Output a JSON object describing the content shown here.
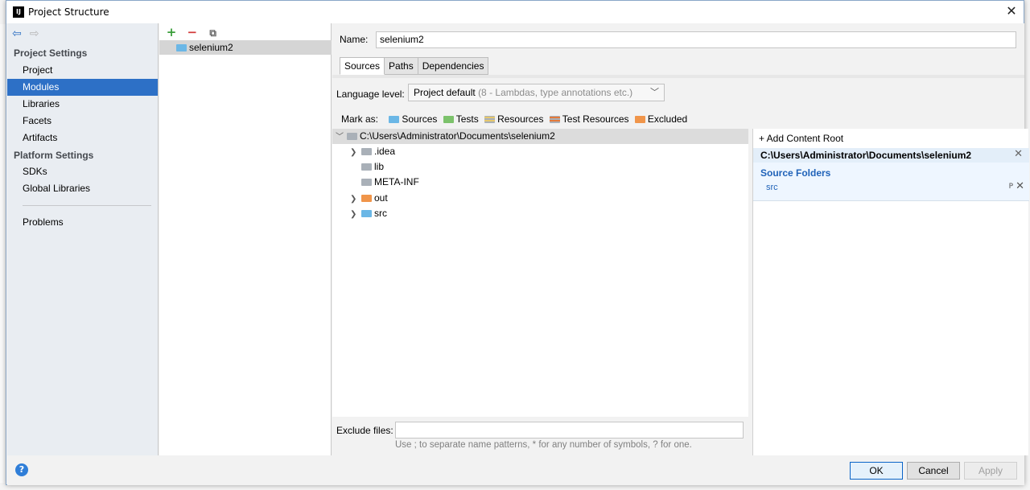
{
  "window": {
    "title": "Project Structure",
    "icon_text": "IJ"
  },
  "nav": {
    "back_icon": "⇦",
    "forward_icon": "⇨",
    "sections": [
      {
        "label": "Project Settings"
      },
      {
        "label": "Platform Settings"
      }
    ],
    "items": [
      {
        "label": "Project"
      },
      {
        "label": "Modules"
      },
      {
        "label": "Libraries"
      },
      {
        "label": "Facets"
      },
      {
        "label": "Artifacts"
      },
      {
        "label": "SDKs"
      },
      {
        "label": "Global Libraries"
      },
      {
        "label": "Problems"
      }
    ],
    "selected": "Modules"
  },
  "modules": {
    "toolbar": {
      "add": "+",
      "remove": "−",
      "copy": "⧉"
    },
    "items": [
      {
        "label": "selenium2"
      }
    ]
  },
  "main": {
    "name_label": "Name:",
    "name_value": "selenium2",
    "tabs": [
      {
        "label": "Sources"
      },
      {
        "label": "Paths"
      },
      {
        "label": "Dependencies"
      }
    ],
    "active_tab": "Sources",
    "language_level_label": "Language level:",
    "language_level_value": "Project default",
    "language_level_hint": "(8 - Lambdas, type annotations etc.)",
    "mark_as_label": "Mark as:",
    "mark_as_options": [
      {
        "label": "Sources",
        "color": "#6bb7e6"
      },
      {
        "label": "Tests",
        "color": "#7cc26b"
      },
      {
        "label": "Resources",
        "color": "#a9b0b8"
      },
      {
        "label": "Test Resources",
        "color": "#e47a3a"
      },
      {
        "label": "Excluded",
        "color": "#f0954a"
      }
    ],
    "tree": {
      "root": "C:\\Users\\Administrator\\Documents\\selenium2",
      "children": [
        {
          "label": ".idea",
          "expandable": true,
          "folder_color": "#a9b0b8"
        },
        {
          "label": "lib",
          "expandable": false,
          "folder_color": "#a9b0b8"
        },
        {
          "label": "META-INF",
          "expandable": false,
          "folder_color": "#a9b0b8"
        },
        {
          "label": "out",
          "expandable": true,
          "folder_color": "#f0954a"
        },
        {
          "label": "src",
          "expandable": true,
          "folder_color": "#6bb7e6"
        }
      ]
    },
    "exclude_label": "Exclude files:",
    "exclude_value": "",
    "exclude_hint": "Use ; to separate name patterns, * for any number of symbols, ? for one."
  },
  "content_roots": {
    "add_label": "+ Add Content Root",
    "root_path": "C:\\Users\\Administrator\\Documents\\selenium2",
    "source_folders_title": "Source Folders",
    "source_folders": [
      {
        "label": "src"
      }
    ],
    "edit_icon": "P"
  },
  "footer": {
    "help_label": "?",
    "ok": "OK",
    "cancel": "Cancel",
    "apply": "Apply"
  }
}
